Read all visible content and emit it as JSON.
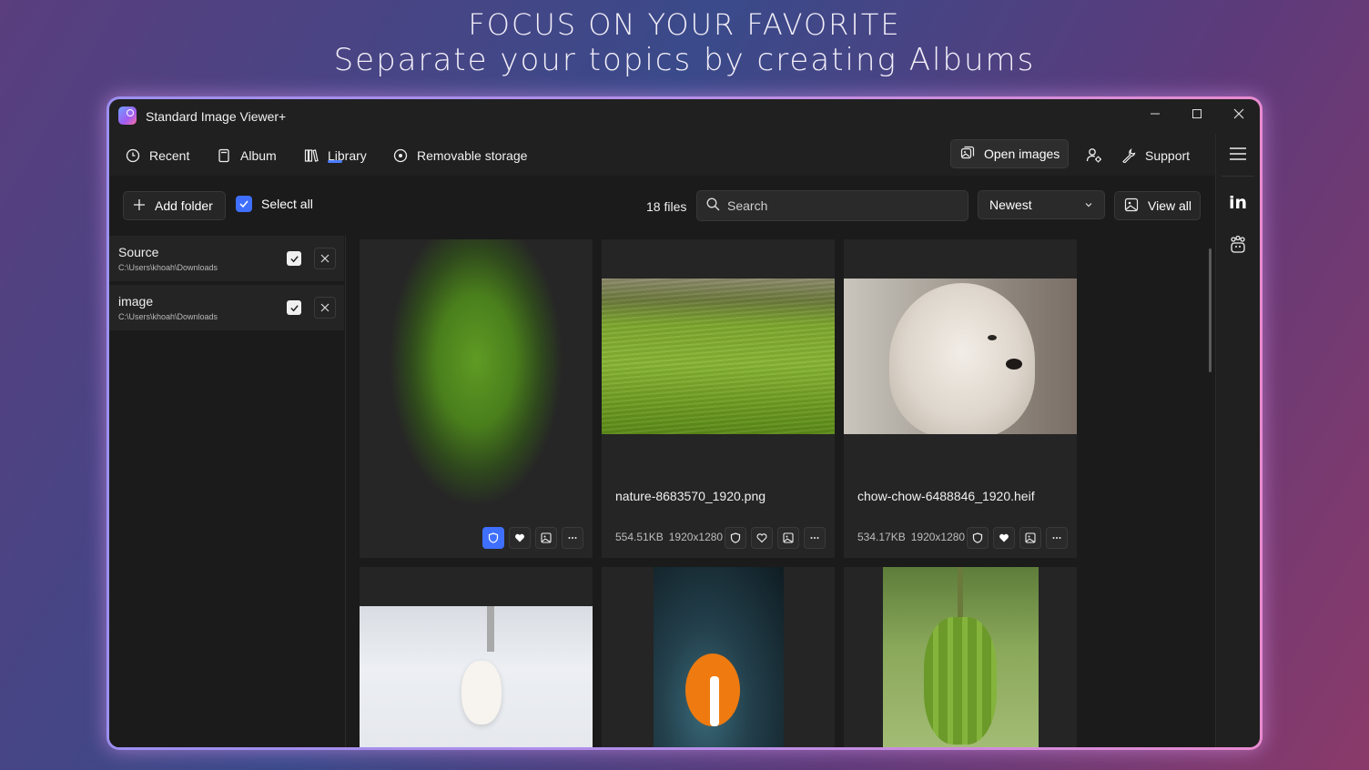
{
  "hero": {
    "line1": "FOCUS ON YOUR FAVORITE",
    "line2": "Separate your topics by creating Albums"
  },
  "app": {
    "title": "Standard Image Viewer+"
  },
  "nav": {
    "items": [
      {
        "label": "Recent",
        "icon": "clock-icon"
      },
      {
        "label": "Album",
        "icon": "album-icon"
      },
      {
        "label": "Library",
        "icon": "library-icon",
        "active": true
      },
      {
        "label": "Removable storage",
        "icon": "disc-icon"
      }
    ],
    "open_images": "Open images",
    "support": "Support"
  },
  "toolbar": {
    "add_folder": "Add folder",
    "select_all": "Select all",
    "files_count": "18 files",
    "search_placeholder": "Search",
    "sort_value": "Newest",
    "view_all": "View all"
  },
  "folders": [
    {
      "name": "Source",
      "path": "C:\\Users\\khoah\\Downloads"
    },
    {
      "name": "image",
      "path": "C:\\Users\\khoah\\Downloads"
    }
  ],
  "images": [
    {
      "name": "",
      "size": "",
      "resolution": "",
      "desc": "blurred green",
      "protected": true,
      "favorite": true
    },
    {
      "name": "nature-8683570_1920.png",
      "size": "554.51KB",
      "resolution": "1920x1280",
      "desc": "grass field",
      "protected": false,
      "favorite": false
    },
    {
      "name": "chow-chow-6488846_1920.heif",
      "size": "534.17KB",
      "resolution": "1920x1280",
      "desc": "white dog",
      "protected": false,
      "favorite": true
    },
    {
      "name": "",
      "desc": "white cat in snow"
    },
    {
      "name": "",
      "desc": "clownfish in anemone"
    },
    {
      "name": "",
      "desc": "green bananas"
    }
  ],
  "colors": {
    "accent": "#3f6fff",
    "window_bg": "#202020",
    "content_bg": "#1b1b1b",
    "card_bg": "#252525",
    "frame_glow": "#e98bd0"
  }
}
